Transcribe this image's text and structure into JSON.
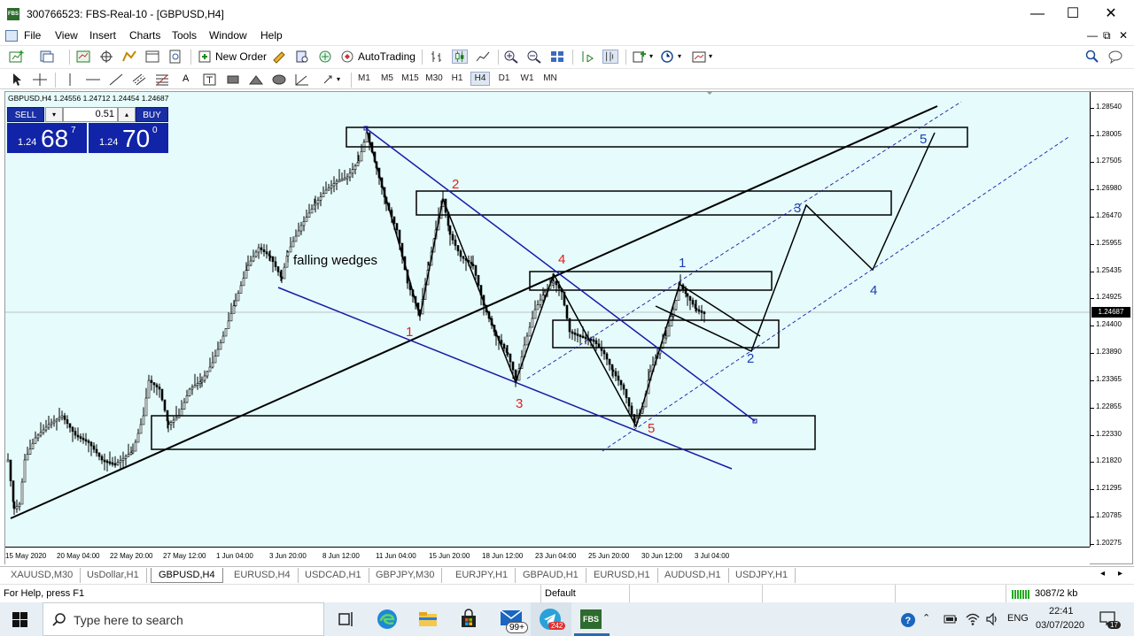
{
  "window": {
    "title": "300766523: FBS-Real-10 - [GBPUSD,H4]",
    "app_badge": "FBS",
    "minimize": "—",
    "maximize": "☐",
    "close": "✕"
  },
  "menu": [
    "File",
    "View",
    "Insert",
    "Charts",
    "Tools",
    "Window",
    "Help"
  ],
  "mdi_controls": {
    "minimize": "—",
    "restore": "⧉",
    "close": "✕"
  },
  "toolbar": {
    "new_order_label": "New Order",
    "autotrading_label": "AutoTrading",
    "timeframes": [
      "M1",
      "M5",
      "M15",
      "M30",
      "H1",
      "H4",
      "D1",
      "W1",
      "MN"
    ],
    "active_timeframe": "H4"
  },
  "chart": {
    "symbol_info": "GBPUSD,H4  1.24556 1.24712 1.24454 1.24687",
    "current_price": "1.24687",
    "annotation_text": "falling wedges",
    "wave_labels_red": [
      "1",
      "2",
      "3",
      "4",
      "5"
    ],
    "wave_labels_blue": [
      "1",
      "2",
      "3",
      "4",
      "5"
    ],
    "background_color": "#e6fbfb",
    "trend_line_color": "#1a1aa8",
    "wave_label_red_color": "#e02020",
    "wave_label_blue_color": "#1a3fb0"
  },
  "trade_panel": {
    "sell_label": "SELL",
    "buy_label": "BUY",
    "volume": "0.51",
    "sell_price": {
      "prefix": "1.24",
      "big": "68",
      "sup": "7"
    },
    "buy_price": {
      "prefix": "1.24",
      "big": "70",
      "sup": "0"
    }
  },
  "y_axis_ticks": [
    "1.28540",
    "1.28005",
    "1.27505",
    "1.26980",
    "1.26470",
    "1.25955",
    "1.25435",
    "1.24925",
    "1.24400",
    "1.23890",
    "1.23365",
    "1.22855",
    "1.22330",
    "1.21820",
    "1.21295",
    "1.20785",
    "1.20275"
  ],
  "x_axis_ticks": [
    "15 May 2020",
    "20 May 04:00",
    "22 May 20:00",
    "27 May 12:00",
    "1 Jun 04:00",
    "3 Jun 20:00",
    "8 Jun 12:00",
    "11 Jun 04:00",
    "15 Jun 20:00",
    "18 Jun 12:00",
    "23 Jun 04:00",
    "25 Jun 20:00",
    "30 Jun 12:00",
    "3 Jul 04:00"
  ],
  "chart_tabs": [
    "XAUUSD,M30",
    "UsDollar,H1",
    "GBPUSD,H4",
    "EURUSD,H4",
    "USDCAD,H1",
    "GBPJPY,M30",
    "EURJPY,H1",
    "GBPAUD,H1",
    "EURUSD,H1",
    "AUDUSD,H1",
    "USDJPY,H1"
  ],
  "active_tab": "GBPUSD,H4",
  "status": {
    "help_text": "For Help, press F1",
    "profile": "Default",
    "traffic": "3087/2 kb"
  },
  "taskbar": {
    "search_placeholder": "Type here to search",
    "mail_badge": "99+",
    "telegram_badge": "242",
    "fbs_label": "FBS",
    "language": "ENG",
    "time": "22:41",
    "date": "03/07/2020",
    "notification_count": "17"
  }
}
